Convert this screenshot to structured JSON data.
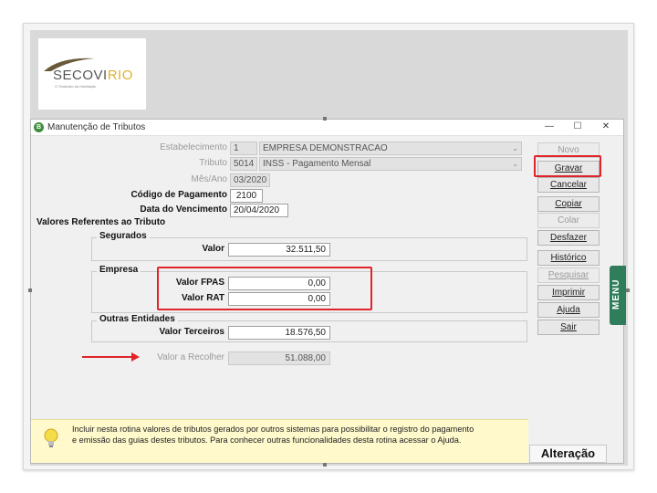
{
  "logo": {
    "brand_prefix": "SECOVI",
    "brand_suffix": "RIO",
    "tagline": "O Sindicato da Habitação"
  },
  "window": {
    "title": "Manutenção de Tributos",
    "controls": {
      "minimize": "—",
      "maximize": "☐",
      "close": "✕"
    }
  },
  "form": {
    "estabelecimento": {
      "label": "Estabelecimento",
      "code": "1",
      "name": "EMPRESA DEMONSTRACAO"
    },
    "tributo": {
      "label": "Tributo",
      "code": "5014",
      "name": "INSS - Pagamento Mensal"
    },
    "mes_ano": {
      "label": "Mês/Ano",
      "value": "03/2020"
    },
    "codigo_pagamento": {
      "label": "Código de Pagamento",
      "value": "2100"
    },
    "data_vencimento": {
      "label": "Data do Vencimento",
      "value": "20/04/2020"
    },
    "section_title": "Valores Referentes ao Tributo",
    "segurados": {
      "title": "Segurados",
      "valor_label": "Valor",
      "valor": "32.511,50"
    },
    "empresa": {
      "title": "Empresa",
      "fpas_label": "Valor FPAS",
      "fpas": "0,00",
      "rat_label": "Valor RAT",
      "rat": "0,00"
    },
    "outras": {
      "title": "Outras Entidades",
      "terceiros_label": "Valor Terceiros",
      "terceiros": "18.576,50"
    },
    "recolher": {
      "label": "Valor a Recolher",
      "value": "51.088,00"
    }
  },
  "buttons": {
    "novo": "Novo",
    "gravar": "Gravar",
    "cancelar": "Cancelar",
    "copiar": "Copiar",
    "colar": "Colar",
    "desfazer": "Desfazer",
    "historico": "Histórico",
    "pesquisar": "Pesquisar",
    "imprimir": "Imprimir",
    "ajuda": "Ajuda",
    "sair": "Sair"
  },
  "menu_tab": "MENU",
  "info": {
    "line1": "Incluir nesta rotina valores de tributos gerados por outros sistemas para possibilitar o registro do pagamento",
    "line2": "e emissão das guias destes tributos. Para conhecer outras funcionalidades desta rotina acessar o Ajuda."
  },
  "status": "Alteração",
  "colors": {
    "highlight": "#e0242a",
    "menu_tab": "#2f7d5b",
    "info_bg": "#fff9cc"
  }
}
